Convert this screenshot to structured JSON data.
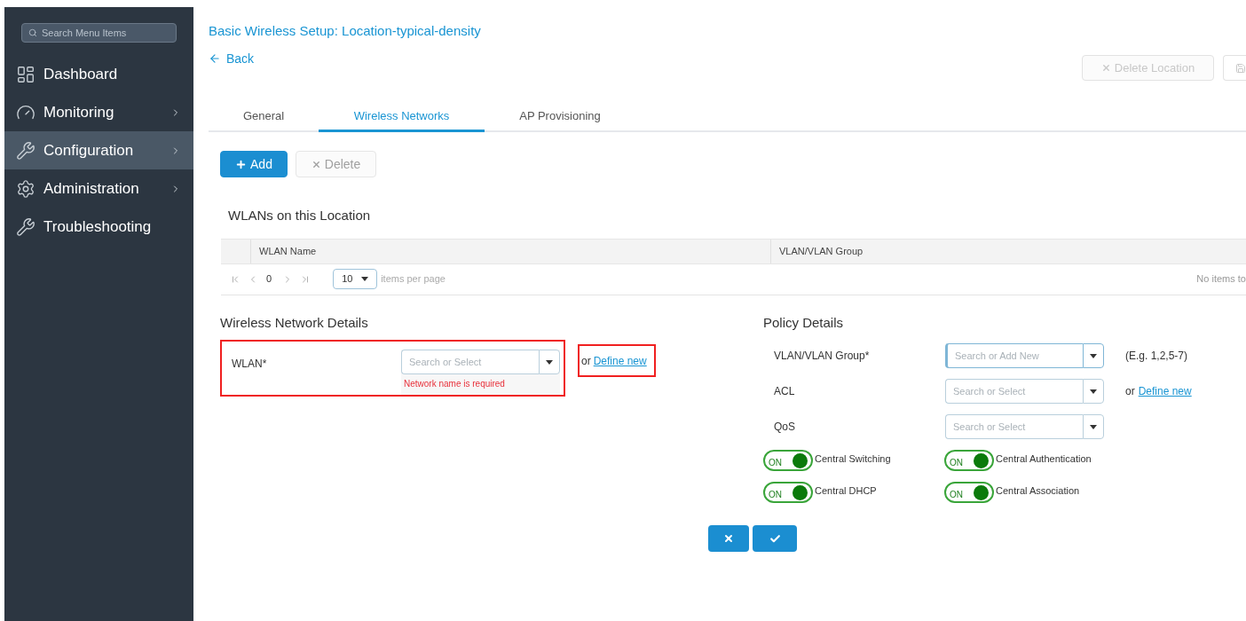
{
  "sidebar": {
    "search": {
      "placeholder": "Search Menu Items"
    },
    "items": [
      {
        "label": "Dashboard",
        "selected": false,
        "expandable": false
      },
      {
        "label": "Monitoring",
        "selected": false,
        "expandable": true
      },
      {
        "label": "Configuration",
        "selected": true,
        "expandable": true
      },
      {
        "label": "Administration",
        "selected": false,
        "expandable": true
      },
      {
        "label": "Troubleshooting",
        "selected": false,
        "expandable": false
      }
    ]
  },
  "header": {
    "title": "Basic Wireless Setup: Location-typical-density",
    "back": "Back",
    "actions": [
      {
        "kind": "delete",
        "label": "Delete Location",
        "disabled": true
      },
      {
        "kind": "save",
        "disabled": true
      }
    ]
  },
  "tabs": [
    {
      "label": "General",
      "selected": false
    },
    {
      "label": "Wireless Networks",
      "selected": true
    },
    {
      "label": "AP Provisioning",
      "selected": false
    }
  ],
  "toolbar": [
    {
      "kind": "add",
      "label": "Add",
      "disabled": false
    },
    {
      "kind": "delete",
      "label": "Delete",
      "disabled": true
    }
  ],
  "wlans": {
    "title": "WLANs on this Location",
    "columns": [
      "WLAN Name",
      "VLAN/VLAN Group"
    ],
    "pager": {
      "page": "0",
      "page_size": "10",
      "per_page_label": "items per page",
      "empty": "No items to"
    }
  },
  "wireless_details": {
    "title": "Wireless Network Details",
    "label": "WLAN*",
    "placeholder": "Search or Select",
    "error": "Network name is required",
    "or": "or",
    "link": "Define new",
    "highlighted": true
  },
  "policy_details": {
    "title": "Policy Details",
    "fields": [
      {
        "label": "VLAN/VLAN Group*",
        "placeholder": "Search or Add New",
        "focused": true,
        "hint": "(E.g. 1,2,5-7)"
      },
      {
        "label": "ACL",
        "placeholder": "Search or Select",
        "focused": false,
        "or": "or",
        "link": "Define new"
      },
      {
        "label": "QoS",
        "placeholder": "Search or Select",
        "focused": false
      }
    ],
    "toggles": [
      {
        "label": "Central Switching",
        "on": true,
        "state_label": "ON"
      },
      {
        "label": "Central Authentication",
        "on": true,
        "state_label": "ON"
      },
      {
        "label": "Central DHCP",
        "on": true,
        "state_label": "ON"
      },
      {
        "label": "Central Association",
        "on": true,
        "state_label": "ON"
      }
    ]
  },
  "footer": [
    {
      "kind": "cancel"
    },
    {
      "kind": "confirm"
    }
  ]
}
